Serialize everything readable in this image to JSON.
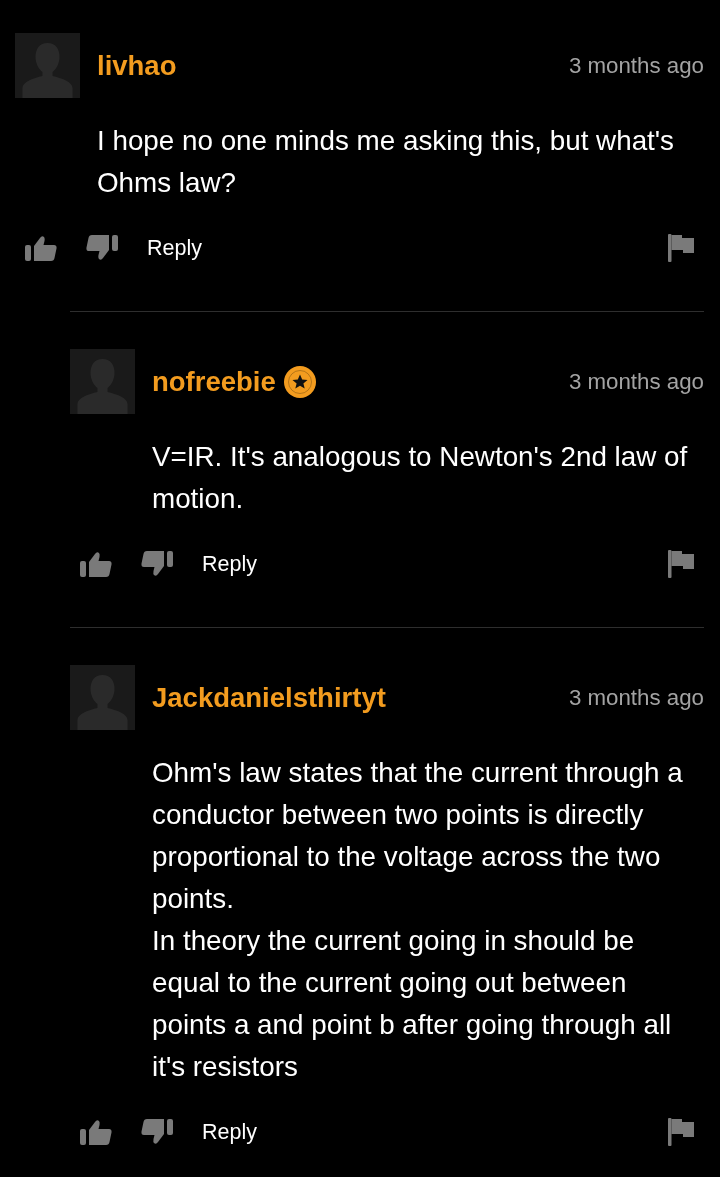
{
  "comments": [
    {
      "username": "livhao",
      "verified": false,
      "time": "3 months ago",
      "text": [
        "I hope no one minds me asking this, but what's Ohms law?"
      ],
      "reply_label": "Reply",
      "replies": [
        {
          "username": "nofreebie",
          "verified": true,
          "time": "3 months ago",
          "text": [
            "V=IR. It's analogous to Newton's 2nd law of motion."
          ],
          "reply_label": "Reply"
        },
        {
          "username": "Jackdanielsthirtyt",
          "verified": false,
          "time": "3 months ago",
          "text": [
            "Ohm's law states that the current through a conductor between two points is directly proportional to the voltage across the two points.",
            "In theory the current going in should be equal to the current going out between points a and point b after going through all it's resistors"
          ],
          "reply_label": "Reply"
        }
      ]
    }
  ]
}
